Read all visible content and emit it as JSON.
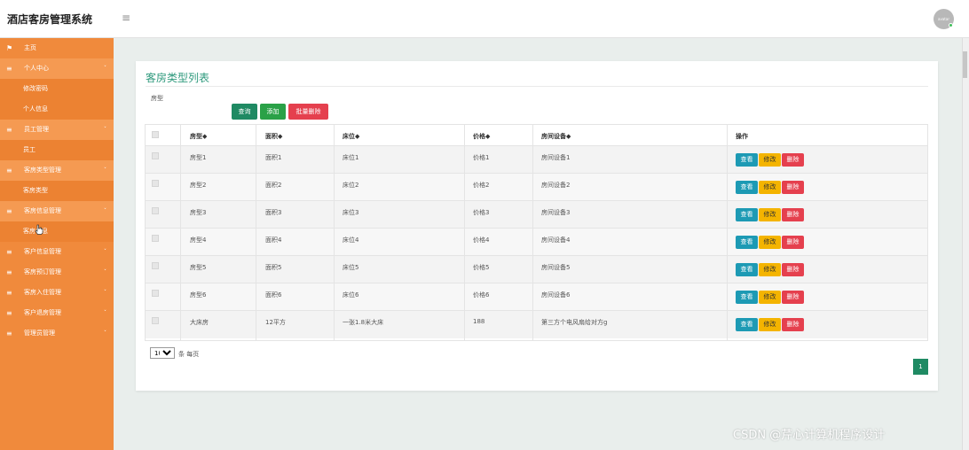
{
  "app": {
    "title": "酒店客房管理系统",
    "avatar_text": "avatar"
  },
  "sidebar": {
    "items": [
      {
        "label": "主页",
        "kind": "top",
        "icon": "flag-icon"
      },
      {
        "label": "个人中心",
        "kind": "group",
        "icon": "menu-icon"
      },
      {
        "label": "修改密码",
        "kind": "sub"
      },
      {
        "label": "个人信息",
        "kind": "sub"
      },
      {
        "label": "员工管理",
        "kind": "group",
        "icon": "menu-icon"
      },
      {
        "label": "员工",
        "kind": "sub"
      },
      {
        "label": "客房类型管理",
        "kind": "group",
        "icon": "menu-icon"
      },
      {
        "label": "客房类型",
        "kind": "sub"
      },
      {
        "label": "客房信息管理",
        "kind": "group",
        "icon": "menu-icon"
      },
      {
        "label": "客房信息",
        "kind": "sub"
      },
      {
        "label": "客户信息管理",
        "kind": "top",
        "icon": "menu-icon"
      },
      {
        "label": "客房预订管理",
        "kind": "top",
        "icon": "menu-icon"
      },
      {
        "label": "客房入住管理",
        "kind": "top",
        "icon": "menu-icon"
      },
      {
        "label": "客户退房管理",
        "kind": "top",
        "icon": "menu-icon"
      },
      {
        "label": "管理员管理",
        "kind": "top",
        "icon": "menu-icon"
      }
    ]
  },
  "main": {
    "title": "客房类型列表",
    "filter": {
      "label": "房型",
      "value": "",
      "placeholder": ""
    },
    "buttons": {
      "search": "查询",
      "add": "添加",
      "batch_delete": "批量删除"
    },
    "table": {
      "headers": [
        "房型◆",
        "面积◆",
        "床位◆",
        "价格◆",
        "房间设备◆",
        "操作"
      ],
      "rows": [
        [
          "房型1",
          "面积1",
          "床位1",
          "价格1",
          "房间设备1"
        ],
        [
          "房型2",
          "面积2",
          "床位2",
          "价格2",
          "房间设备2"
        ],
        [
          "房型3",
          "面积3",
          "床位3",
          "价格3",
          "房间设备3"
        ],
        [
          "房型4",
          "面积4",
          "床位4",
          "价格4",
          "房间设备4"
        ],
        [
          "房型5",
          "面积5",
          "床位5",
          "价格5",
          "房间设备5"
        ],
        [
          "房型6",
          "面积6",
          "床位6",
          "价格6",
          "房间设备6"
        ],
        [
          "大床房",
          "12平方",
          "一张1.8米大床",
          "188",
          "第三方个电风扇给对方g"
        ]
      ],
      "actions": {
        "view": "查看",
        "edit": "修改",
        "delete": "删除"
      }
    },
    "pagination": {
      "page_size": "10",
      "page_size_label": "条 每页",
      "current_page": "1"
    }
  },
  "watermark": "CSDN @芹心计算机程序设计",
  "colors": {
    "sidebar": "#f08a3c",
    "accent": "#1f8a63",
    "add": "#2aa147",
    "danger": "#e5404e",
    "view": "#1d9ab4",
    "edit": "#f4b400"
  }
}
